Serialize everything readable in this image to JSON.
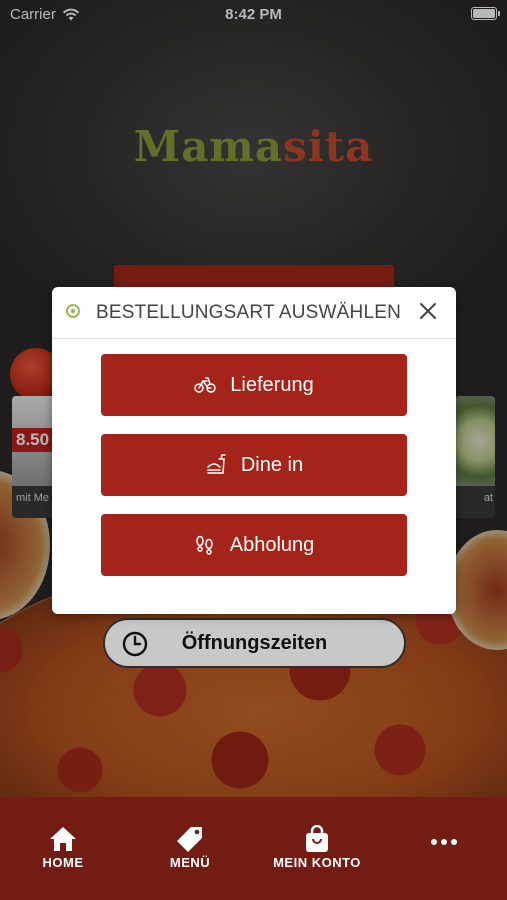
{
  "status_bar": {
    "carrier": "Carrier",
    "time": "8:42 PM"
  },
  "brand": {
    "logo_part1": "Mama",
    "logo_part2": "sita",
    "logo_colors": [
      "#8a9a3a",
      "#c44a2a"
    ]
  },
  "background": {
    "card_left_price": "8.50",
    "card_left_caption": "mit Me",
    "card_right_caption": "at"
  },
  "modal": {
    "title": "BESTELLUNGSART AUSWÄHLEN",
    "options": [
      {
        "label": "Lieferung",
        "icon": "bicycle-icon"
      },
      {
        "label": "Dine in",
        "icon": "fastfood-icon"
      },
      {
        "label": "Abholung",
        "icon": "footsteps-icon"
      }
    ]
  },
  "hours_button": {
    "label": "Öffnungszeiten",
    "icon": "clock-icon"
  },
  "tabbar": {
    "items": [
      {
        "label": "HOME",
        "icon": "home-icon"
      },
      {
        "label": "MENÜ",
        "icon": "tag-icon"
      },
      {
        "label": "MEIN KONTO",
        "icon": "shopping-bag-icon"
      },
      {
        "label": "",
        "icon": "more-icon"
      }
    ]
  },
  "colors": {
    "accent_red": "#a5241a",
    "tabbar": "#731c14"
  }
}
